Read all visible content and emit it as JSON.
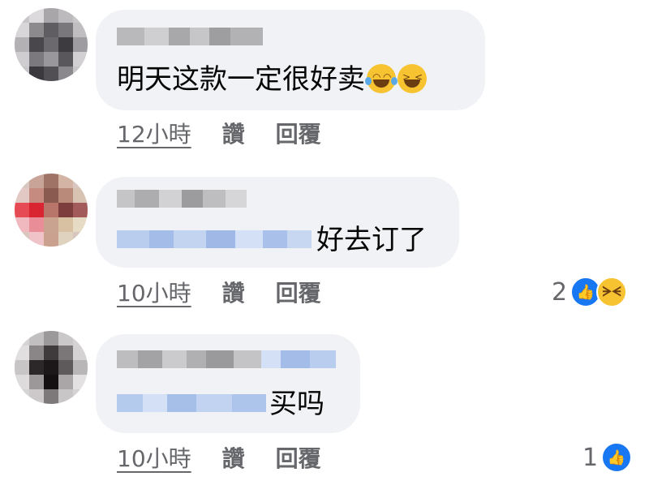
{
  "comments": [
    {
      "text": "明天这款一定很好卖",
      "emojis": [
        "tears-of-joy-icon",
        "grinning-squinting-icon"
      ],
      "time": "12小時",
      "like": "讚",
      "reply": "回覆",
      "reaction_count": ""
    },
    {
      "text": "好去订了",
      "time": "10小時",
      "like": "讚",
      "reply": "回覆",
      "reaction_count": "2",
      "reaction_icons": [
        "like-icon",
        "haha-icon"
      ]
    },
    {
      "text": "买吗",
      "time": "10小時",
      "like": "讚",
      "reply": "回覆",
      "reaction_count": "1",
      "reaction_icons": [
        "like-icon"
      ]
    }
  ],
  "colors": {
    "bubble": "#f0f2f5",
    "meta_text": "#65676b",
    "like_blue": "#1877f2",
    "haha_yellow": "#f7c331",
    "mention_blur": "#aac4ea"
  }
}
